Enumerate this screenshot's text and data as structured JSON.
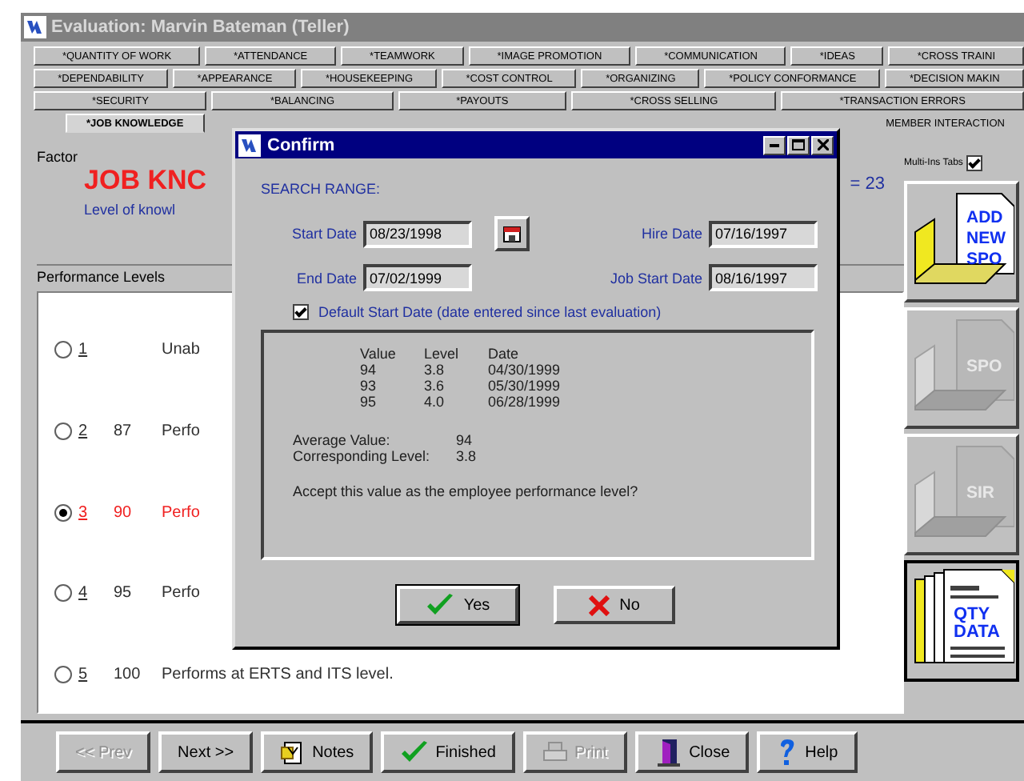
{
  "window": {
    "title": "Evaluation: Marvin Bateman (Teller)"
  },
  "tab_rows": [
    [
      {
        "label": "*QUANTITY OF WORK",
        "selected": false
      },
      {
        "label": "*ATTENDANCE",
        "selected": false
      },
      {
        "label": "*TEAMWORK",
        "selected": false
      },
      {
        "label": "*IMAGE PROMOTION",
        "selected": false
      },
      {
        "label": "*COMMUNICATION",
        "selected": false
      },
      {
        "label": "*IDEAS",
        "selected": false
      },
      {
        "label": "*CROSS TRAINI",
        "selected": false
      }
    ],
    [
      {
        "label": "*DEPENDABILITY",
        "selected": false
      },
      {
        "label": "*APPEARANCE",
        "selected": false
      },
      {
        "label": "*HOUSEKEEPING",
        "selected": false
      },
      {
        "label": "*COST CONTROL",
        "selected": false
      },
      {
        "label": "*ORGANIZING",
        "selected": false
      },
      {
        "label": "*POLICY CONFORMANCE",
        "selected": false
      },
      {
        "label": "*DECISION MAKIN",
        "selected": false
      }
    ],
    [
      {
        "label": "*SECURITY",
        "selected": false
      },
      {
        "label": "*BALANCING",
        "selected": false
      },
      {
        "label": "*PAYOUTS",
        "selected": false
      },
      {
        "label": "*CROSS SELLING",
        "selected": false
      },
      {
        "label": "*TRANSACTION ERRORS",
        "selected": false
      }
    ],
    [
      {
        "label": "*JOB KNOWLEDGE",
        "selected": true
      },
      {
        "label": "MEMBER INTERACTION",
        "selected": false
      }
    ]
  ],
  "factor": {
    "label": "Factor",
    "name": "JOB KNC",
    "description": "Level of knowl",
    "score": "= 23"
  },
  "multi_tabs": {
    "label": "Multi-Ins Tabs",
    "checked": true
  },
  "performance": {
    "title": "Performance Levels",
    "levels": [
      {
        "number": "1",
        "text": "Unab",
        "selected": false
      },
      {
        "number": "2",
        "value": "87",
        "text": "Perfo",
        "selected": false
      },
      {
        "number": "3",
        "value": "90",
        "text": "Perfo",
        "selected": true
      },
      {
        "number": "4",
        "value": "95",
        "text": "Perfo",
        "selected": false
      },
      {
        "number": "5",
        "value": "100",
        "text": "Performs at ERTS and ITS level.",
        "selected": false
      }
    ]
  },
  "side_buttons": [
    {
      "kind": "folder",
      "lines": [
        "ADD",
        "NEW",
        "SPO"
      ],
      "disabled": false
    },
    {
      "kind": "folder",
      "lines": [
        "SPO"
      ],
      "disabled": true
    },
    {
      "kind": "folder",
      "lines": [
        "SIR"
      ],
      "disabled": true
    },
    {
      "kind": "stack",
      "lines": [
        "QTY",
        "DATA"
      ],
      "disabled": false
    }
  ],
  "toolbar": [
    {
      "label": "<< Prev",
      "disabled": true
    },
    {
      "label": "Next >>",
      "disabled": false
    },
    {
      "kind": "notes",
      "label": "Notes",
      "disabled": false
    },
    {
      "kind": "check",
      "label": "Finished",
      "disabled": false
    },
    {
      "kind": "printer",
      "label": "Print",
      "disabled": true
    },
    {
      "kind": "door",
      "label": "Close",
      "disabled": false
    },
    {
      "kind": "help",
      "label": "Help",
      "disabled": false
    }
  ],
  "dialog": {
    "title": "Confirm",
    "section": "SEARCH RANGE:",
    "fields": [
      {
        "label": "Start Date",
        "value": "08/23/1998"
      },
      {
        "label": "Hire Date",
        "value": "07/16/1997"
      },
      {
        "label": "End Date",
        "value": "07/02/1999"
      },
      {
        "label": "Job Start Date",
        "value": "08/16/1997"
      }
    ],
    "default_start": {
      "label": "Default Start Date (date entered since last evaluation)",
      "checked": true
    },
    "summary": {
      "columns": [
        "Value",
        "Level",
        "Date"
      ],
      "rows": [
        [
          "94",
          "3.8",
          "04/30/1999"
        ],
        [
          "93",
          "3.6",
          "05/30/1999"
        ],
        [
          "95",
          "4.0",
          "06/28/1999"
        ]
      ],
      "stats": [
        {
          "label": "Average Value:",
          "value": "94"
        },
        {
          "label": "Corresponding Level:",
          "value": "3.8"
        }
      ],
      "question": "Accept this value as the employee performance level?"
    },
    "buttons": [
      {
        "kind": "yes",
        "label": "Yes"
      },
      {
        "kind": "no",
        "label": "No"
      }
    ]
  }
}
